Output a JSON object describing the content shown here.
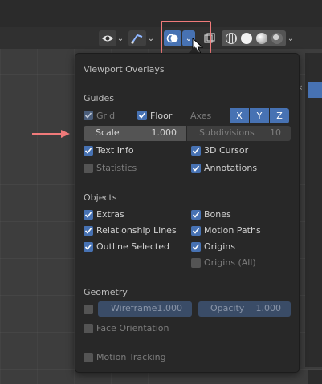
{
  "header": {
    "overlay_toggle_icon": "overlay-circles-icon",
    "shading_modes": [
      "wireframe",
      "solid",
      "material-preview",
      "rendered"
    ]
  },
  "popover": {
    "title": "Viewport Overlays",
    "guides": {
      "heading": "Guides",
      "grid": {
        "label": "Grid",
        "checked": true
      },
      "floor": {
        "label": "Floor",
        "checked": true
      },
      "axes_label": "Axes",
      "axes": [
        "X",
        "Y",
        "Z"
      ],
      "scale": {
        "label": "Scale",
        "value": "1.000"
      },
      "subdivisions": {
        "label": "Subdivisions",
        "value": "10"
      },
      "text_info": {
        "label": "Text Info",
        "checked": true
      },
      "cursor_3d": {
        "label": "3D Cursor",
        "checked": true
      },
      "statistics": {
        "label": "Statistics",
        "checked": false
      },
      "annotations": {
        "label": "Annotations",
        "checked": true
      }
    },
    "objects": {
      "heading": "Objects",
      "extras": {
        "label": "Extras",
        "checked": true
      },
      "bones": {
        "label": "Bones",
        "checked": true
      },
      "relationship_lines": {
        "label": "Relationship Lines",
        "checked": true
      },
      "motion_paths": {
        "label": "Motion Paths",
        "checked": true
      },
      "outline_selected": {
        "label": "Outline Selected",
        "checked": true
      },
      "origins": {
        "label": "Origins",
        "checked": true
      },
      "origins_all": {
        "label": "Origins (All)",
        "checked": false
      }
    },
    "geometry": {
      "heading": "Geometry",
      "wireframe": {
        "label": "Wireframe",
        "value": "1.000",
        "checked": false
      },
      "opacity": {
        "label": "Opacity",
        "value": "1.000"
      },
      "face_orientation": {
        "label": "Face Orientation",
        "checked": false
      }
    },
    "motion_tracking": {
      "label": "Motion Tracking",
      "checked": false
    }
  },
  "colors": {
    "accent": "#4772b3",
    "highlight": "#f07a7a",
    "panel": "#282828"
  }
}
